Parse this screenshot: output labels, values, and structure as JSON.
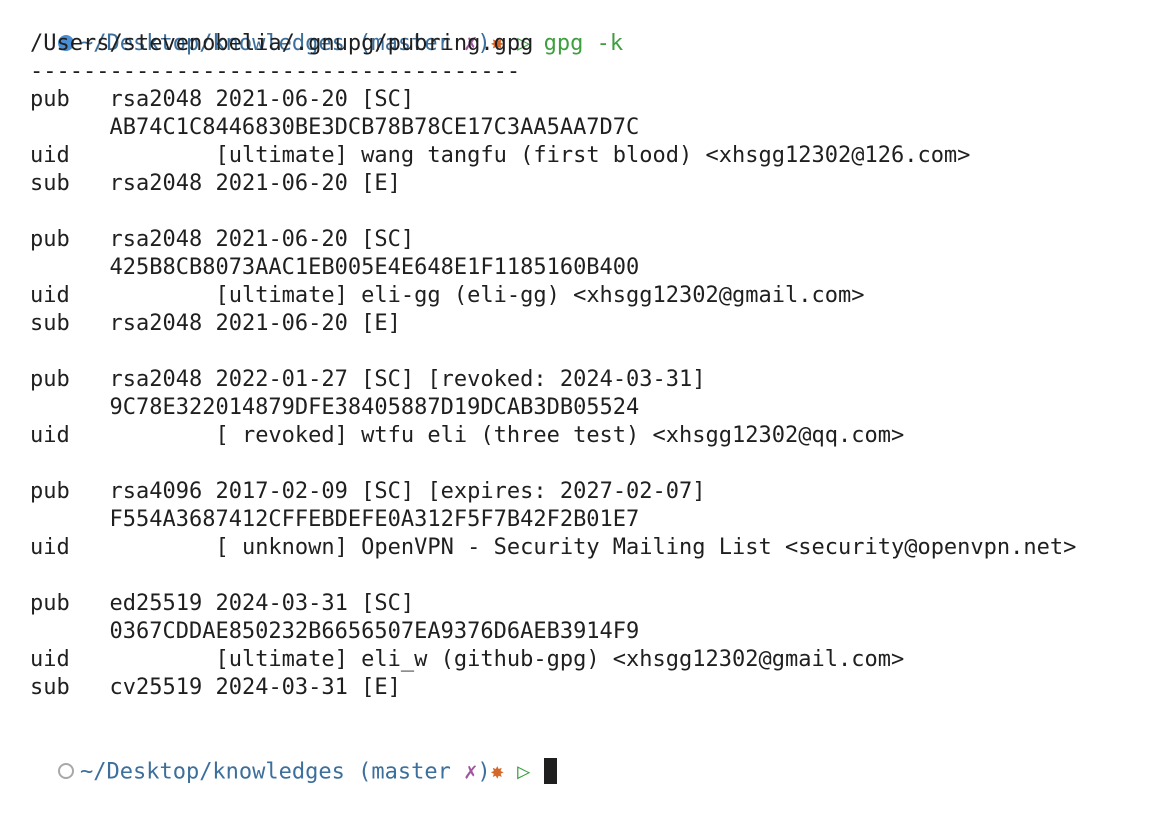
{
  "prompt1": {
    "path": "~/Desktop/knowledges",
    "branch_open": "(",
    "branch": "master",
    "dirty": "✗",
    "branch_close": ")",
    "star": "✸",
    "arrow": "▷",
    "command": "gpg -k"
  },
  "output": {
    "keyring_path": "/Users/stevenobelia/.gnupg/pubring.gpg",
    "separator": "-------------------------------------",
    "keys": [
      {
        "pub_label": "pub",
        "pub_info": "rsa2048 2021-06-20 [SC]",
        "fingerprint": "AB74C1C8446830BE3DCB78B78CE17C3AA5AA7D7C",
        "uid_label": "uid",
        "uid_info": "[ultimate] wang tangfu (first blood) <xhsgg12302@126.com>",
        "sub_label": "sub",
        "sub_info": "rsa2048 2021-06-20 [E]"
      },
      {
        "pub_label": "pub",
        "pub_info": "rsa2048 2021-06-20 [SC]",
        "fingerprint": "425B8CB8073AAC1EB005E4E648E1F1185160B400",
        "uid_label": "uid",
        "uid_info": "[ultimate] eli-gg (eli-gg) <xhsgg12302@gmail.com>",
        "sub_label": "sub",
        "sub_info": "rsa2048 2021-06-20 [E]"
      },
      {
        "pub_label": "pub",
        "pub_info": "rsa2048 2022-01-27 [SC] [revoked: 2024-03-31]",
        "fingerprint": "9C78E322014879DFE38405887D19DCAB3DB05524",
        "uid_label": "uid",
        "uid_info": "[ revoked] wtfu eli (three test) <xhsgg12302@qq.com>"
      },
      {
        "pub_label": "pub",
        "pub_info": "rsa4096 2017-02-09 [SC] [expires: 2027-02-07]",
        "fingerprint": "F554A3687412CFFEBDEFE0A312F5F7B42F2B01E7",
        "uid_label": "uid",
        "uid_info": "[ unknown] OpenVPN - Security Mailing List <security@openvpn.net>"
      },
      {
        "pub_label": "pub",
        "pub_info": "ed25519 2024-03-31 [SC]",
        "fingerprint": "0367CDDAE850232B6656507EA9376D6AEB3914F9",
        "uid_label": "uid",
        "uid_info": "[ultimate] eli_w (github-gpg) <xhsgg12302@gmail.com>",
        "sub_label": "sub",
        "sub_info": "cv25519 2024-03-31 [E]"
      }
    ]
  },
  "prompt2": {
    "path": "~/Desktop/knowledges",
    "branch_open": "(",
    "branch": "master",
    "dirty": "✗",
    "branch_close": ")",
    "star": "✸",
    "arrow": "▷"
  },
  "colors": {
    "path": "#3c6f9c",
    "dirty": "#a0569e",
    "star": "#d4682a",
    "command": "#3d9f3d",
    "status_dot_active": "#4a8fd6",
    "status_dot_idle": "#a8a8a8"
  }
}
